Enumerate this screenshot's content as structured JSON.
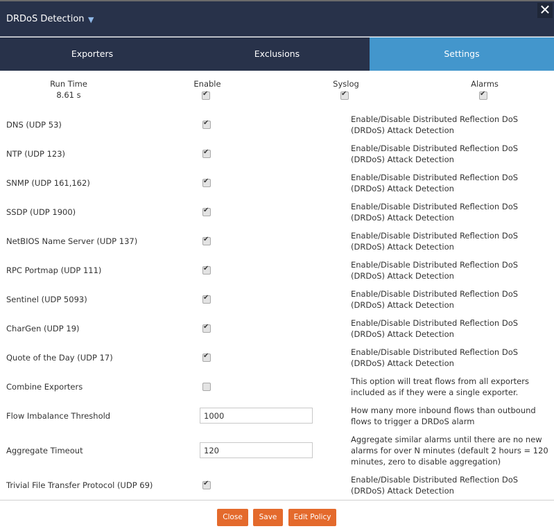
{
  "header": {
    "title": "DRDoS Detection",
    "caret_icon": "▼",
    "close_icon": "✕"
  },
  "tabs": [
    {
      "label": "Exporters",
      "active": false
    },
    {
      "label": "Exclusions",
      "active": false
    },
    {
      "label": "Settings",
      "active": true
    }
  ],
  "summary": {
    "run_time_label": "Run Time",
    "run_time_value": "8.61 s",
    "enable_label": "Enable",
    "enable_checked": true,
    "syslog_label": "Syslog",
    "syslog_checked": true,
    "alarms_label": "Alarms",
    "alarms_checked": true
  },
  "rows": [
    {
      "label": "DNS (UDP 53)",
      "type": "checkbox",
      "checked": true,
      "desc": "Enable/Disable Distributed Reflection DoS (DRDoS) Attack Detection"
    },
    {
      "label": "NTP (UDP 123)",
      "type": "checkbox",
      "checked": true,
      "desc": "Enable/Disable Distributed Reflection DoS (DRDoS) Attack Detection"
    },
    {
      "label": "SNMP (UDP 161,162)",
      "type": "checkbox",
      "checked": true,
      "desc": "Enable/Disable Distributed Reflection DoS (DRDoS) Attack Detection"
    },
    {
      "label": "SSDP (UDP 1900)",
      "type": "checkbox",
      "checked": true,
      "desc": "Enable/Disable Distributed Reflection DoS (DRDoS) Attack Detection"
    },
    {
      "label": "NetBIOS Name Server (UDP 137)",
      "type": "checkbox",
      "checked": true,
      "desc": "Enable/Disable Distributed Reflection DoS (DRDoS) Attack Detection"
    },
    {
      "label": "RPC Portmap (UDP 111)",
      "type": "checkbox",
      "checked": true,
      "desc": "Enable/Disable Distributed Reflection DoS (DRDoS) Attack Detection"
    },
    {
      "label": "Sentinel (UDP 5093)",
      "type": "checkbox",
      "checked": true,
      "desc": "Enable/Disable Distributed Reflection DoS (DRDoS) Attack Detection"
    },
    {
      "label": "CharGen (UDP 19)",
      "type": "checkbox",
      "checked": true,
      "desc": "Enable/Disable Distributed Reflection DoS (DRDoS) Attack Detection"
    },
    {
      "label": "Quote of the Day (UDP 17)",
      "type": "checkbox",
      "checked": true,
      "desc": "Enable/Disable Distributed Reflection DoS (DRDoS) Attack Detection"
    },
    {
      "label": "Combine Exporters",
      "type": "checkbox",
      "checked": false,
      "desc": "This option will treat flows from all exporters included as if they were a single exporter."
    },
    {
      "label": "Flow Imbalance Threshold",
      "type": "input",
      "value": "1000",
      "desc": "How many more inbound flows than outbound flows to trigger a DRDoS alarm"
    },
    {
      "label": "Aggregate Timeout",
      "type": "input",
      "value": "120",
      "desc": "Aggregate similar alarms until there are no new alarms for over N minutes (default 2 hours = 120 minutes, zero to disable aggregation)"
    },
    {
      "label": "Trivial File Transfer Protocol (UDP 69)",
      "type": "checkbox",
      "checked": true,
      "desc": "Enable/Disable Distributed Reflection DoS (DRDoS) Attack Detection"
    }
  ],
  "footer": {
    "close_label": "Close",
    "save_label": "Save",
    "edit_policy_label": "Edit Policy"
  },
  "colors": {
    "header_bg": "#28324a",
    "active_tab": "#4396cc",
    "button": "#e46a2c"
  }
}
